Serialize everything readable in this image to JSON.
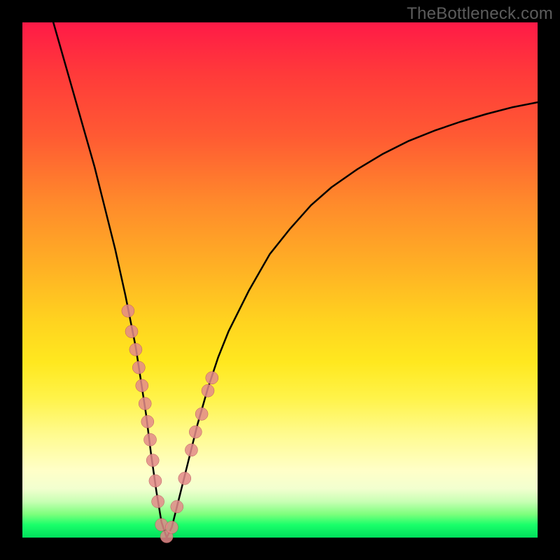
{
  "watermark": "TheBottleneck.com",
  "chart_data": {
    "type": "line",
    "title": "",
    "xlabel": "",
    "ylabel": "",
    "xlim": [
      0,
      100
    ],
    "ylim": [
      0,
      100
    ],
    "grid": false,
    "series": [
      {
        "name": "bottleneck-curve",
        "x": [
          6,
          8,
          10,
          12,
          14,
          16,
          18,
          20,
          22,
          24,
          25,
          26,
          27,
          28,
          29,
          30,
          32,
          34,
          36,
          38,
          40,
          44,
          48,
          52,
          56,
          60,
          65,
          70,
          75,
          80,
          85,
          90,
          95,
          100
        ],
        "values": [
          100,
          93,
          86,
          79,
          72,
          64,
          56,
          47,
          37,
          24,
          16,
          9,
          3,
          0,
          2,
          6,
          14,
          22,
          29,
          35,
          40,
          48,
          55,
          60,
          64.5,
          68,
          71.5,
          74.5,
          77,
          79,
          80.7,
          82.2,
          83.5,
          84.5
        ]
      }
    ],
    "scatter_points": {
      "name": "highlighted-points",
      "x": [
        20.5,
        21.2,
        22.0,
        22.6,
        23.2,
        23.8,
        24.3,
        24.8,
        25.3,
        25.8,
        26.3,
        27.0,
        28.0,
        29.0,
        30.0,
        31.5,
        32.8,
        33.6,
        34.8,
        36.0,
        36.8
      ],
      "values": [
        44,
        40,
        36.5,
        33,
        29.5,
        26,
        22.5,
        19,
        15,
        11,
        7,
        2.5,
        0.2,
        2.0,
        6.0,
        11.5,
        17,
        20.5,
        24,
        28.5,
        31
      ]
    },
    "gradient_stops": [
      {
        "pos": 0.0,
        "color": "#ff1a47"
      },
      {
        "pos": 0.1,
        "color": "#ff3a3a"
      },
      {
        "pos": 0.22,
        "color": "#ff5a33"
      },
      {
        "pos": 0.35,
        "color": "#ff8a2b"
      },
      {
        "pos": 0.48,
        "color": "#ffb224"
      },
      {
        "pos": 0.58,
        "color": "#ffd31f"
      },
      {
        "pos": 0.66,
        "color": "#ffe81f"
      },
      {
        "pos": 0.73,
        "color": "#fff34a"
      },
      {
        "pos": 0.8,
        "color": "#fffb8f"
      },
      {
        "pos": 0.87,
        "color": "#ffffc8"
      },
      {
        "pos": 0.905,
        "color": "#f2ffcf"
      },
      {
        "pos": 0.93,
        "color": "#c8ffb4"
      },
      {
        "pos": 0.955,
        "color": "#7cff7c"
      },
      {
        "pos": 0.975,
        "color": "#1aff6a"
      },
      {
        "pos": 1.0,
        "color": "#00e05c"
      }
    ]
  }
}
